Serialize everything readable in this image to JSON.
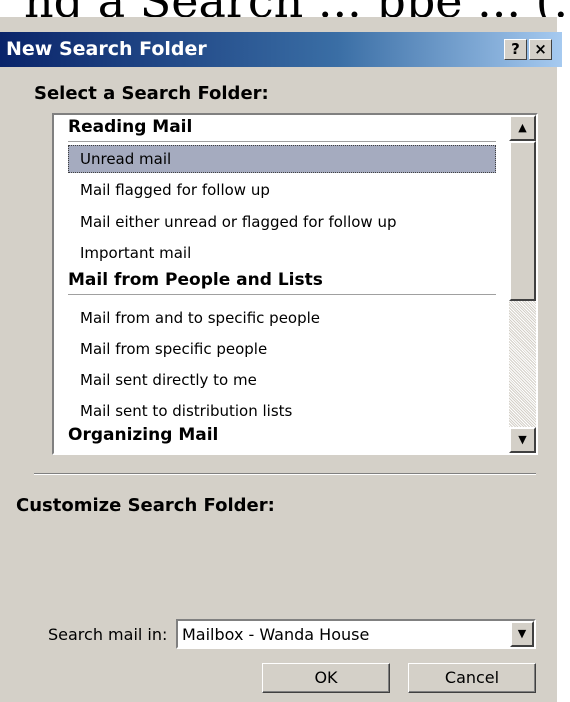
{
  "background_caption": "ng a Search ... ppe ... (...",
  "dialog": {
    "title": "New Search Folder",
    "help_button": "?",
    "close_button": "×"
  },
  "select_label": "Select a Search Folder:",
  "list": {
    "groups": [
      {
        "title": "Reading Mail",
        "items": [
          "Unread mail",
          "Mail flagged for follow up",
          "Mail either unread or flagged for follow up",
          "Important mail"
        ]
      },
      {
        "title": "Mail from People and Lists",
        "items": [
          "Mail from and to specific people",
          "Mail from specific people",
          "Mail sent directly to me",
          "Mail sent to distribution lists"
        ]
      },
      {
        "title": "Organizing Mail",
        "items": []
      }
    ],
    "selected_item": "Unread mail"
  },
  "customize_label": "Customize Search Folder:",
  "search_in": {
    "label": "Search mail in:",
    "value": "Mailbox - Wanda House"
  },
  "buttons": {
    "ok": "OK",
    "cancel": "Cancel"
  },
  "icons": {
    "scroll_up": "arrow-up-icon",
    "scroll_down": "arrow-down-icon",
    "dropdown": "chevron-down-icon"
  }
}
